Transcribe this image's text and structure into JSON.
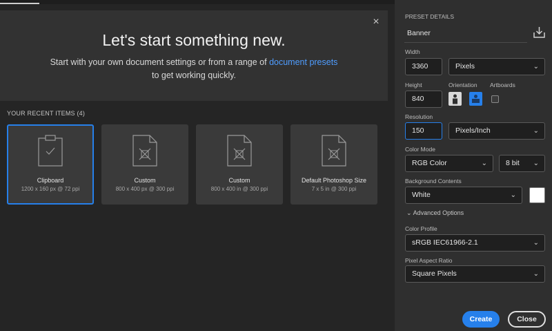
{
  "hero": {
    "close_icon": "×",
    "title": "Let's start something new.",
    "subtitle_before": "Start with your own document settings or from a range of ",
    "subtitle_link": "document presets",
    "subtitle_after": " to get working quickly."
  },
  "recent": {
    "title": "YOUR RECENT ITEMS",
    "count": "(4)",
    "items": [
      {
        "name": "Clipboard",
        "meta": "1200 x 160 px @ 72 ppi",
        "icon": "clipboard-doc-icon",
        "selected": true
      },
      {
        "name": "Custom",
        "meta": "800 x 400 px @ 300 ppi",
        "icon": "custom-doc-icon"
      },
      {
        "name": "Custom",
        "meta": "800 x 400 in @ 300 ppi",
        "icon": "custom-doc-icon"
      },
      {
        "name": "Default Photoshop Size",
        "meta": "7 x 5 in @ 300 ppi",
        "icon": "custom-doc-icon"
      }
    ]
  },
  "panel": {
    "preset_details_label": "PRESET DETAILS",
    "preset_name": "Banner",
    "width_label": "Width",
    "width_value": "3360",
    "width_unit": "Pixels",
    "height_label": "Height",
    "height_value": "840",
    "orientation_label": "Orientation",
    "artboards_label": "Artboards",
    "resolution_label": "Resolution",
    "resolution_value": "150",
    "resolution_unit": "Pixels/Inch",
    "color_mode_label": "Color Mode",
    "color_mode_value": "RGB Color",
    "bit_depth_value": "8 bit",
    "background_label": "Background Contents",
    "background_value": "White",
    "advanced_label": "Advanced Options",
    "color_profile_label": "Color Profile",
    "color_profile_value": "sRGB IEC61966-2.1",
    "pixel_aspect_label": "Pixel Aspect Ratio",
    "pixel_aspect_value": "Square Pixels",
    "create_label": "Create",
    "close_label": "Close"
  },
  "colors": {
    "accent": "#2680eb",
    "link": "#4f9dff",
    "background_swatch": "#ffffff"
  }
}
